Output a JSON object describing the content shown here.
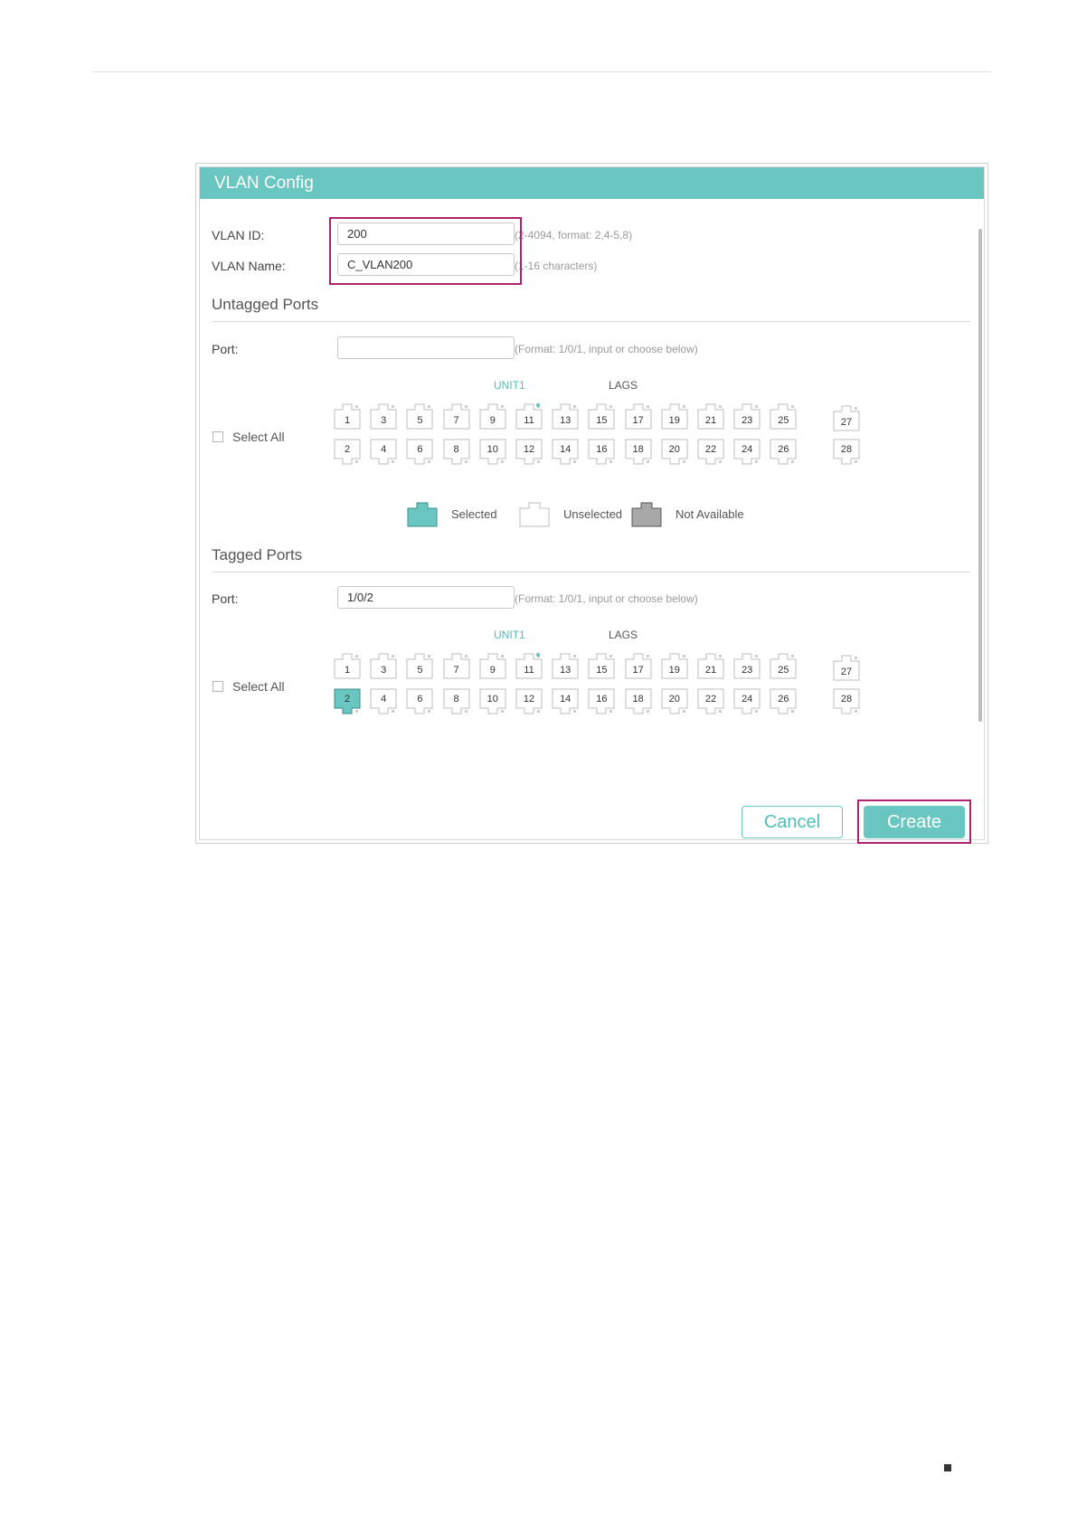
{
  "window": {
    "title": "VLAN Config"
  },
  "vlan_id": {
    "label": "VLAN ID:",
    "value": "200",
    "hint": "(2-4094, format: 2,4-5,8)"
  },
  "vlan_name": {
    "label": "VLAN Name:",
    "value": "C_VLAN200",
    "hint": "(1-16 characters)"
  },
  "untagged": {
    "title": "Untagged Ports",
    "port_label": "Port:",
    "port_value": "",
    "port_hint": "(Format: 1/0/1, input or choose below)",
    "unit_label": "UNIT1",
    "lags_label": "LAGS",
    "select_all": "Select All",
    "selected_ports": []
  },
  "legend": {
    "selected": "Selected",
    "unselected": "Unselected",
    "not_available": "Not Available"
  },
  "tagged": {
    "title": "Tagged Ports",
    "port_label": "Port:",
    "port_value": "1/0/2",
    "port_hint": "(Format: 1/0/1, input or choose below)",
    "unit_label": "UNIT1",
    "lags_label": "LAGS",
    "select_all": "Select All",
    "selected_ports": [
      2
    ]
  },
  "ports": {
    "top_row": [
      "1",
      "3",
      "5",
      "7",
      "9",
      "11",
      "13",
      "15",
      "17",
      "19",
      "21",
      "23",
      "25"
    ],
    "bottom_row": [
      "2",
      "4",
      "6",
      "8",
      "10",
      "12",
      "14",
      "16",
      "18",
      "20",
      "22",
      "24",
      "26"
    ],
    "sfp_top": "27",
    "sfp_bottom": "28",
    "active_indicator_port": "11"
  },
  "colors": {
    "accent": "#6ac6c1",
    "highlight": "#b0246f",
    "not_available": "#a8a8a8"
  },
  "buttons": {
    "cancel": "Cancel",
    "create": "Create"
  }
}
